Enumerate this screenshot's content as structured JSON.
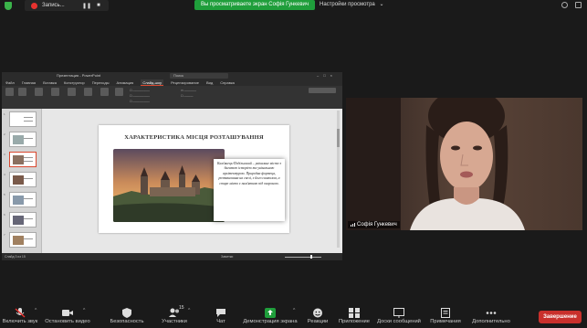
{
  "top_bar": {
    "recording_label": "Запись...",
    "pause_icon": "pause-icon",
    "stop_icon": "stop-icon",
    "screen_notice": "Вы просматриваете экран Софія Гункевич",
    "view_options": "Настройки просмотра",
    "accent_green": "#1f9e3b"
  },
  "powerpoint": {
    "window_title": "Презентация - PowerPoint",
    "search_placeholder": "Поиск",
    "tabs": [
      "Файл",
      "Главная",
      "Вставка",
      "Конструктор",
      "Переходы",
      "Анимация",
      "Слайд-шоу",
      "Рецензирование",
      "Вид",
      "Справка"
    ],
    "active_tab": "Слайд-шоу",
    "slide_title": "ХАРАКТЕРИСТИКА МІСЦЯ РОЗТАШУВАННЯ",
    "slide_text": "Кам'янець-Подільський – унікальне місто з багатою історією та унікальною архітектурою. Природна фортеця, розташована на скелі, є його символом, а старе місто є пам'яткою під охороною.",
    "status_left": "Слайд 3 из 15",
    "status_right": "Заметки"
  },
  "webcam": {
    "participant_name": "Софія Гункевич"
  },
  "toolbar": {
    "items": [
      {
        "label": "Включить звук",
        "icon": "mic-muted-icon"
      },
      {
        "label": "Остановить видео",
        "icon": "video-camera-icon"
      },
      {
        "label": "Безопасность",
        "icon": "shield-icon"
      },
      {
        "label": "Участники",
        "icon": "participants-icon",
        "count": "15"
      },
      {
        "label": "Чат",
        "icon": "chat-icon"
      },
      {
        "label": "Демонстрация экрана",
        "icon": "share-screen-icon"
      },
      {
        "label": "Реакции",
        "icon": "reaction-icon"
      },
      {
        "label": "Приложение",
        "icon": "apps-icon"
      },
      {
        "label": "Доски сообщений",
        "icon": "whiteboard-icon"
      },
      {
        "label": "Примечания",
        "icon": "notes-icon"
      },
      {
        "label": "Дополнительно",
        "icon": "more-icon"
      }
    ],
    "end_label": "Завершение",
    "end_color": "#c9302c"
  }
}
